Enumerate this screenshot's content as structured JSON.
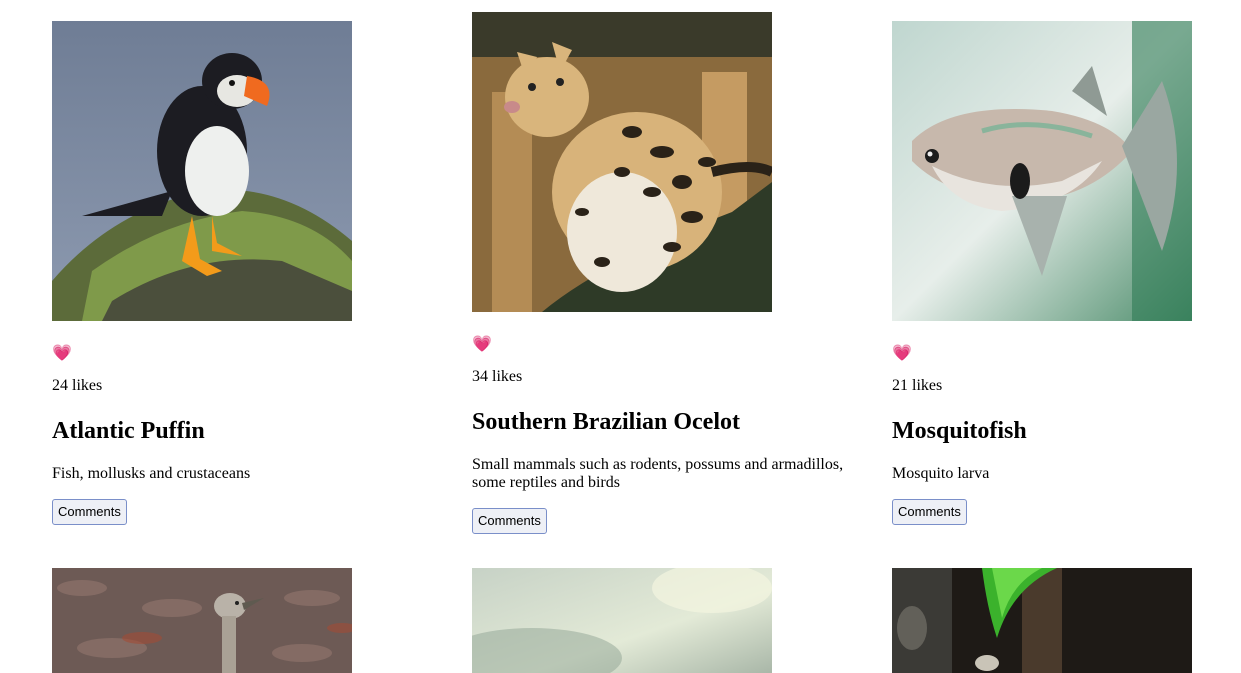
{
  "cards": [
    {
      "heart": "💗",
      "likes": "24 likes",
      "name": "Atlantic Puffin",
      "diet": "Fish, mollusks and crustaceans",
      "button": "Comments",
      "image": "puffin"
    },
    {
      "heart": "💗",
      "likes": "34 likes",
      "name": "Southern Brazilian Ocelot",
      "diet": "Small mammals such as rodents, possums and armadillos, some reptiles and birds",
      "button": "Comments",
      "image": "ocelot"
    },
    {
      "heart": "💗",
      "likes": "21 likes",
      "name": "Mosquitofish",
      "diet": "Mosquito larva",
      "button": "Comments",
      "image": "mosquitofish"
    }
  ],
  "bottom_images": [
    "bustard-bird",
    "blurred-foliage",
    "plant-stream"
  ]
}
